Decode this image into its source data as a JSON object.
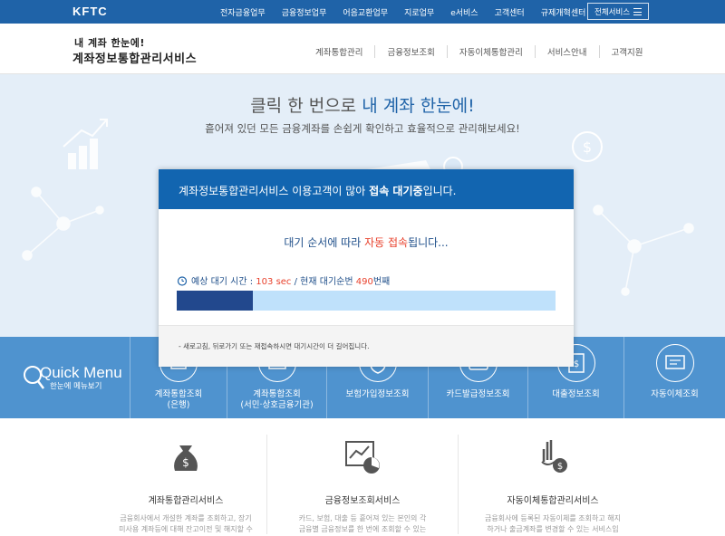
{
  "topbar": {
    "logo": "KFTC",
    "nav": [
      "전자금융업무",
      "금융정보업무",
      "어음교환업무",
      "지로업무",
      "e서비스",
      "고객센터",
      "규제개혁센터"
    ],
    "all_services": "전체서비스"
  },
  "header": {
    "title_line1": "내 계좌 한눈에!",
    "title_line2": "계좌정보통합관리서비스",
    "menu": [
      "계좌통합관리",
      "금융정보조회",
      "자동이체통합관리",
      "서비스안내",
      "고객지원"
    ]
  },
  "hero": {
    "headline_prefix": "클릭 한 번으로 ",
    "headline_highlight": "내 계좌 한눈에!",
    "subline": "흩어져 있던 모든 금융계좌를 손쉽게 확인하고 효율적으로 관리해보세요!"
  },
  "quick_menu": {
    "title": "Quick Menu",
    "subtitle": "한눈에 메뉴보기",
    "items": [
      {
        "line1": "계좌통합조회",
        "line2": "(은행)"
      },
      {
        "line1": "계좌통합조회",
        "line2": "(서민·상호금융기관)"
      },
      {
        "line1": "보험가입정보조회",
        "line2": ""
      },
      {
        "line1": "카드발급정보조회",
        "line2": ""
      },
      {
        "line1": "대출정보조회",
        "line2": ""
      },
      {
        "line1": "자동이체조회",
        "line2": ""
      }
    ]
  },
  "lower": {
    "columns": [
      {
        "title": "계좌통합관리서비스",
        "desc": "금융회사에서 개설한 계좌를 조회하고, 장기 미사용 계좌등에 대해 잔고이전 및 해지할 수 있는"
      },
      {
        "title": "금융정보조회서비스",
        "desc": "카드, 보험, 대출 등 흩어져 있는 본인의 각 금융별 금융정보를 한 번에 조회할 수 있는 서비스"
      },
      {
        "title": "자동이체통합관리서비스",
        "desc": "금융회사에 등록된 자동이체를 조회하고 해지하거나 출금계좌를 변경할 수 있는 서비스입니다"
      }
    ]
  },
  "modal": {
    "header_prefix": "계좌정보통합관리서비스 이용고객이 많아 ",
    "header_bold": "접속 대기중",
    "header_suffix": "입니다.",
    "wait_prefix": "대기 순서에 따라 ",
    "wait_highlight": "자동 접속",
    "wait_suffix": "됩니다...",
    "eta_label": "예상 대기 시간 : ",
    "eta_value": "103 sec",
    "eta_sep": " / 현재 대기순번 ",
    "queue_number": "490",
    "queue_unit": "번째",
    "progress": 0.2,
    "note": "- 새로고침, 뒤로가기 또는 재접속하시면 대기시간이 더 길어집니다."
  },
  "colors": {
    "brand_blue": "#1f63a8",
    "modal_header": "#1265b0",
    "progress_fill": "#22488d",
    "progress_track": "#bfe1fb",
    "highlight_red": "#e8412c",
    "quick_menu_bg": "#4f93cf"
  }
}
